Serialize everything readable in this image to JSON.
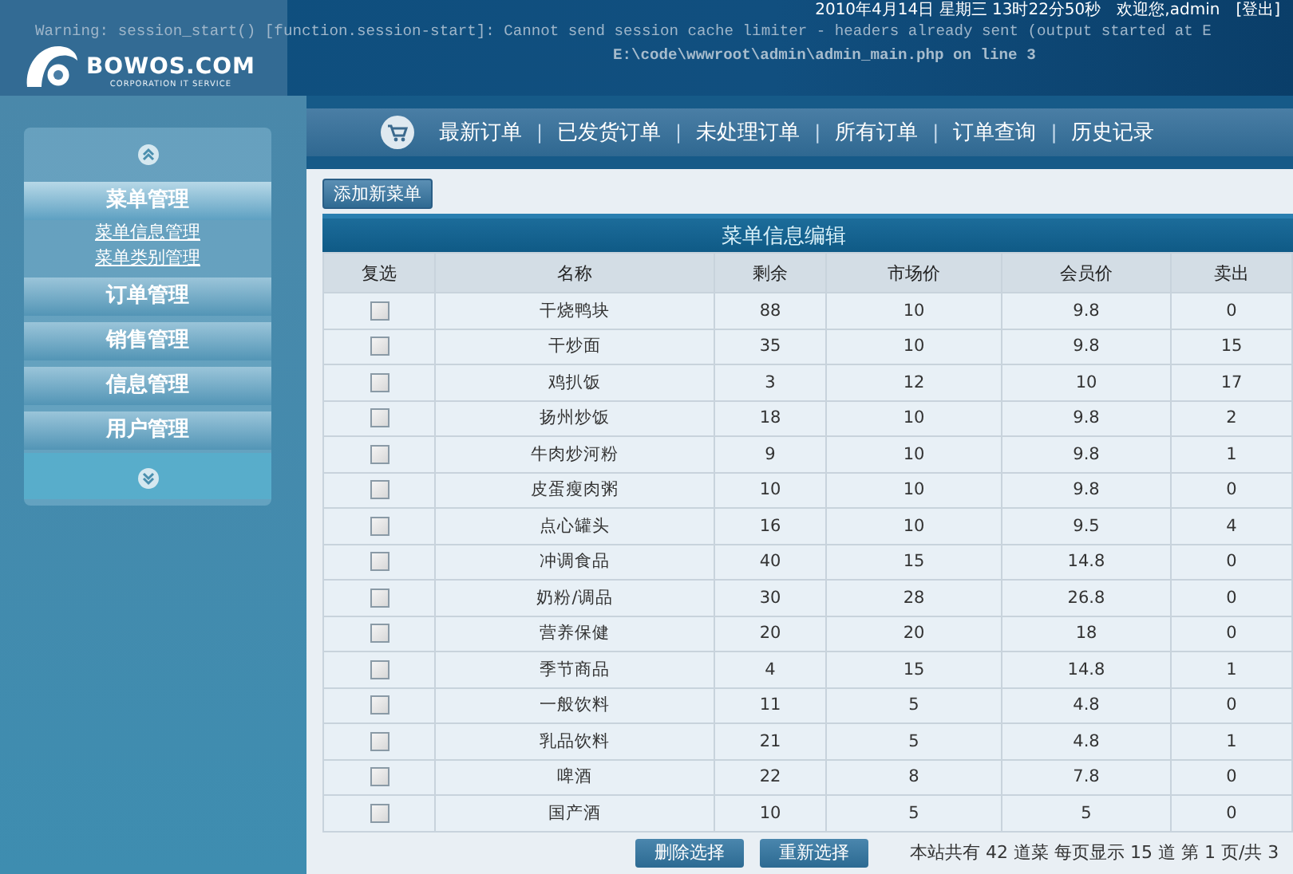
{
  "header": {
    "warning_line_1": "Warning: session_start() [function.session-start]: Cannot send session cache limiter - headers already sent (output started at E",
    "warning_line_2": "E:\\code\\wwwroot\\admin\\admin_main.php on line 3",
    "logo": "BOWOS.COM",
    "logo_tagline": "CORPORATION IT SERVICE",
    "datetime": "2010年4月14日 星期三 13时22分50秒",
    "welcome": "欢迎您,admin",
    "logout": "[登出]"
  },
  "sidebar": {
    "groups": [
      {
        "label": "菜单管理",
        "expanded": true,
        "children": [
          {
            "label": "菜单信息管理"
          },
          {
            "label": "菜单类别管理"
          }
        ]
      },
      {
        "label": "订单管理",
        "expanded": false
      },
      {
        "label": "销售管理",
        "expanded": false
      },
      {
        "label": "信息管理",
        "expanded": false
      },
      {
        "label": "用户管理",
        "expanded": false
      }
    ]
  },
  "nav": {
    "items": [
      {
        "kind": "link",
        "label": "最新订单"
      },
      {
        "kind": "separator",
        "label": "|"
      },
      {
        "kind": "link",
        "label": "已发货订单"
      },
      {
        "kind": "separator",
        "label": "|"
      },
      {
        "kind": "link",
        "label": "未处理订单"
      },
      {
        "kind": "separator",
        "label": "|"
      },
      {
        "kind": "link",
        "label": "所有订单"
      },
      {
        "kind": "separator",
        "label": "|"
      },
      {
        "kind": "link",
        "label": "订单查询"
      },
      {
        "kind": "separator",
        "label": "|"
      },
      {
        "kind": "link",
        "label": "历史记录"
      }
    ]
  },
  "add_button": "添加新菜单",
  "table": {
    "title": "菜单信息编辑",
    "columns": [
      "复选",
      "名称",
      "剩余",
      "市场价",
      "会员价",
      "卖出"
    ],
    "rows": [
      {
        "checked": false,
        "cells": [
          "",
          "干烧鸭块",
          "88",
          "10",
          "9.8",
          "0"
        ]
      },
      {
        "checked": false,
        "cells": [
          "",
          "干炒面",
          "35",
          "10",
          "9.8",
          "15"
        ]
      },
      {
        "checked": false,
        "cells": [
          "",
          "鸡扒饭",
          "3",
          "12",
          "10",
          "17"
        ]
      },
      {
        "checked": false,
        "cells": [
          "",
          "扬州炒饭",
          "18",
          "10",
          "9.8",
          "2"
        ]
      },
      {
        "checked": false,
        "cells": [
          "",
          "牛肉炒河粉",
          "9",
          "10",
          "9.8",
          "1"
        ]
      },
      {
        "checked": false,
        "cells": [
          "",
          "皮蛋瘦肉粥",
          "10",
          "10",
          "9.8",
          "0"
        ]
      },
      {
        "checked": false,
        "cells": [
          "",
          "点心罐头",
          "16",
          "10",
          "9.5",
          "4"
        ]
      },
      {
        "checked": false,
        "cells": [
          "",
          "冲调食品",
          "40",
          "15",
          "14.8",
          "0"
        ]
      },
      {
        "checked": false,
        "cells": [
          "",
          "奶粉/调品",
          "30",
          "28",
          "26.8",
          "0"
        ]
      },
      {
        "checked": false,
        "cells": [
          "",
          "营养保健",
          "20",
          "20",
          "18",
          "0"
        ]
      },
      {
        "checked": false,
        "cells": [
          "",
          "季节商品",
          "4",
          "15",
          "14.8",
          "1"
        ]
      },
      {
        "checked": false,
        "cells": [
          "",
          "一般饮料",
          "11",
          "5",
          "4.8",
          "0"
        ]
      },
      {
        "checked": false,
        "cells": [
          "",
          "乳品饮料",
          "21",
          "5",
          "4.8",
          "1"
        ]
      },
      {
        "checked": false,
        "cells": [
          "",
          "啤酒",
          "22",
          "8",
          "7.8",
          "0"
        ]
      },
      {
        "checked": false,
        "cells": [
          "",
          "国产酒",
          "10",
          "5",
          "5",
          "0"
        ]
      }
    ]
  },
  "footer": {
    "buttons": [
      "删除选择",
      "重新选择"
    ],
    "pagination": "本站共有 42 道菜 每页显示 15 道 第 1 页/共 3"
  }
}
